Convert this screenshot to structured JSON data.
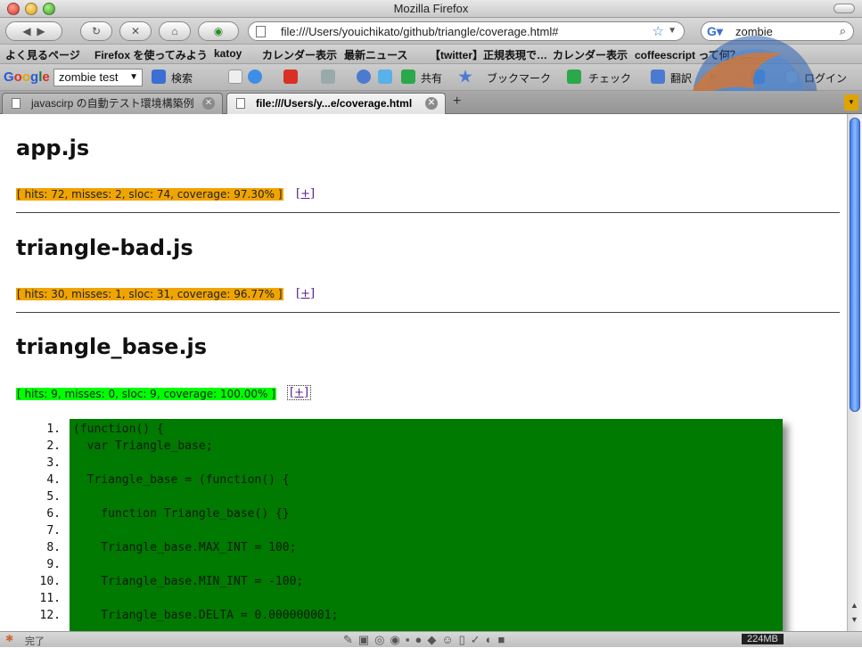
{
  "window": {
    "title": "Mozilla Firefox"
  },
  "nav": {
    "url": "file:///Users/youichikato/github/triangle/coverage.html#",
    "search_value": "zombie"
  },
  "bookmarks": [
    "よく見るページ",
    "Firefox を使ってみよう",
    "katoy",
    "カレンダー表示",
    "最新ニュース",
    "【twitter】正規表現で…",
    "カレンダー表示",
    "coffeescript って何？…"
  ],
  "toolbar2": {
    "google_search_value": "zombie test",
    "search_label": "検索",
    "share_label": "共有",
    "bookmark_label": "ブックマーク",
    "check_label": "チェック",
    "translate_label": "翻訳",
    "login_label": "ログイン"
  },
  "tabs": [
    {
      "label": "javascirp の自動テスト環境構築例"
    },
    {
      "label": "file:///Users/y...e/coverage.html"
    }
  ],
  "status": {
    "text": "完了",
    "memory": "224MB"
  },
  "colors": {
    "partial": "#f0a400",
    "full": "#00ff00",
    "code_bg": "#007a00"
  },
  "files": [
    {
      "name": "app.js",
      "stats": "[ hits: 72, misses: 2, sloc: 74, coverage: 97.30% ]",
      "expander": "[+]"
    },
    {
      "name": "triangle-bad.js",
      "stats": "[ hits: 30, misses: 1, sloc: 31, coverage: 96.77% ]",
      "expander": "[+]"
    },
    {
      "name": "triangle_base.js",
      "stats": "[ hits: 9, misses: 0, sloc: 9, coverage: 100.00% ]",
      "expander": "[+]"
    }
  ],
  "code": [
    {
      "n": "1.",
      "text": "(function() {"
    },
    {
      "n": "2.",
      "text": "  var Triangle_base;"
    },
    {
      "n": "3.",
      "text": ""
    },
    {
      "n": "4.",
      "text": "  Triangle_base = (function() {"
    },
    {
      "n": "5.",
      "text": ""
    },
    {
      "n": "6.",
      "text": "    function Triangle_base() {}"
    },
    {
      "n": "7.",
      "text": ""
    },
    {
      "n": "8.",
      "text": "    Triangle_base.MAX_INT = 100;"
    },
    {
      "n": "9.",
      "text": ""
    },
    {
      "n": "10.",
      "text": "    Triangle_base.MIN_INT = -100;"
    },
    {
      "n": "11.",
      "text": ""
    },
    {
      "n": "12.",
      "text": "    Triangle_base.DELTA = 0.000000001;"
    }
  ]
}
